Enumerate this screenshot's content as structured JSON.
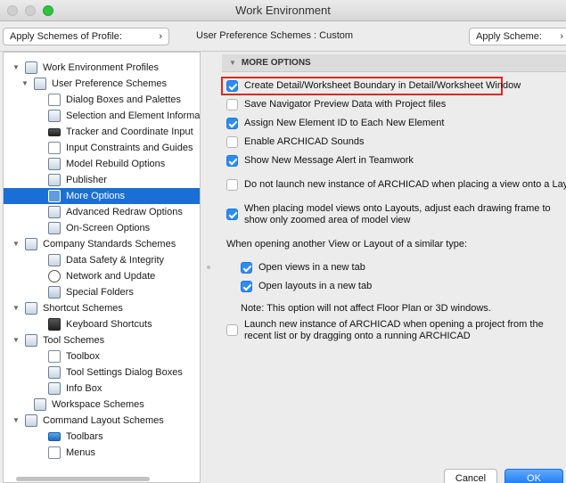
{
  "window": {
    "title": "Work Environment"
  },
  "toolbar": {
    "profile_popup": "Apply Schemes of Profile:",
    "scheme_label": "User Preference Schemes : Custom",
    "apply_popup": "Apply Scheme:"
  },
  "sidebar": {
    "items": [
      {
        "label": "Work Environment Profiles",
        "icon": "profiles-icon"
      },
      {
        "label": "User Preference Schemes",
        "icon": "user-prefs-icon"
      },
      {
        "label": "Dialog Boxes and Palettes",
        "icon": "dialog-boxes-icon"
      },
      {
        "label": "Selection and Element Information",
        "icon": "selection-icon"
      },
      {
        "label": "Tracker and Coordinate Input",
        "icon": "xyz-icon"
      },
      {
        "label": "Input Constraints and Guides",
        "icon": "constraints-icon"
      },
      {
        "label": "Model Rebuild Options",
        "icon": "rebuild-icon"
      },
      {
        "label": "Publisher",
        "icon": "publisher-icon"
      },
      {
        "label": "More Options",
        "icon": "more-options-icon"
      },
      {
        "label": "Advanced Redraw Options",
        "icon": "redraw-icon"
      },
      {
        "label": "On-Screen Options",
        "icon": "onscreen-icon"
      },
      {
        "label": "Company Standards Schemes",
        "icon": "company-icon"
      },
      {
        "label": "Data Safety & Integrity",
        "icon": "data-safety-icon"
      },
      {
        "label": "Network and Update",
        "icon": "globe-icon"
      },
      {
        "label": "Special Folders",
        "icon": "folder-icon"
      },
      {
        "label": "Shortcut Schemes",
        "icon": "shortcut-icon"
      },
      {
        "label": "Keyboard Shortcuts",
        "icon": "keyboard-icon"
      },
      {
        "label": "Tool Schemes",
        "icon": "tool-schemes-icon"
      },
      {
        "label": "Toolbox",
        "icon": "toolbox-icon"
      },
      {
        "label": "Tool Settings Dialog Boxes",
        "icon": "tool-settings-icon"
      },
      {
        "label": "Info Box",
        "icon": "info-box-icon"
      },
      {
        "label": "Workspace Schemes",
        "icon": "workspace-icon"
      },
      {
        "label": "Command Layout Schemes",
        "icon": "command-layout-icon"
      },
      {
        "label": "Toolbars",
        "icon": "toolbars-icon"
      },
      {
        "label": "Menus",
        "icon": "menus-icon"
      }
    ],
    "selected": "More Options"
  },
  "panel": {
    "header": "MORE OPTIONS",
    "options": [
      {
        "label": "Create Detail/Worksheet Boundary in Detail/Worksheet Window",
        "checked": true
      },
      {
        "label": "Save Navigator Preview Data with Project files",
        "checked": false
      },
      {
        "label": "Assign New Element ID to Each New Element",
        "checked": true
      },
      {
        "label": "Enable ARCHICAD Sounds",
        "checked": false
      },
      {
        "label": "Show New Message Alert in Teamwork",
        "checked": true
      },
      {
        "label": "Do not launch new instance of ARCHICAD when placing a view onto a Layout",
        "checked": false
      },
      {
        "label": "When placing model views onto Layouts, adjust each drawing frame to show only zoomed area of model view",
        "checked": true
      }
    ],
    "similar_heading": "When opening another View or Layout of a similar type:",
    "tab_options": [
      {
        "label": "Open views in a new tab",
        "checked": true
      },
      {
        "label": "Open layouts in a new tab",
        "checked": true
      }
    ],
    "note": "Note: This option will not affect Floor Plan or 3D windows.",
    "launch_option": {
      "label": "Launch new instance of ARCHICAD when opening a project from the recent list or by dragging onto a running ARCHICAD",
      "checked": false
    }
  },
  "buttons": {
    "cancel": "Cancel",
    "ok": "OK"
  },
  "colors": {
    "accent": "#1a6fd6",
    "highlight": "#e0281e"
  }
}
